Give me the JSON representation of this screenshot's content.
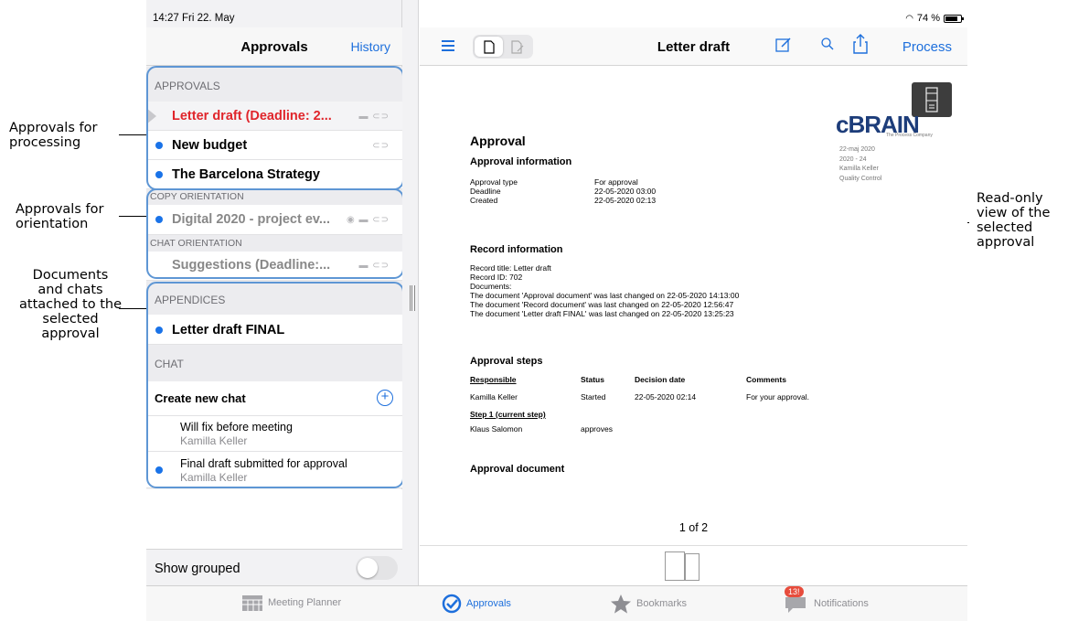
{
  "annotations": {
    "processing": "Approvals for processing",
    "orientation": "Approvals for orientation",
    "attached": "Documents and chats attached to the selected approval",
    "readonly": "Read-only view of the selected approval"
  },
  "status_bar": {
    "time": "14:27  Fri 22. May",
    "battery": "74 %"
  },
  "left_header": {
    "title": "Approvals",
    "history": "History"
  },
  "sections": {
    "approvals": "APPROVALS",
    "copy_orientation": "COPY ORIENTATION",
    "chat_orientation": "CHAT ORIENTATION",
    "appendices": "APPENDICES",
    "chat": "CHAT"
  },
  "approvals": [
    {
      "label": "Letter draft (Deadline: 2...",
      "icons": "▬ ⊂⊃"
    },
    {
      "label": "New budget",
      "icons": "⊂⊃"
    },
    {
      "label": "The Barcelona Strategy",
      "icons": ""
    }
  ],
  "copy_orientation_item": {
    "label": "Digital 2020 - project ev...",
    "icons": "◉ ▬ ⊂⊃"
  },
  "chat_orientation_item": {
    "label": "Suggestions (Deadline:...",
    "icons": "▬ ⊂⊃"
  },
  "appendix_item": {
    "label": "Letter draft FINAL"
  },
  "chat": {
    "create_new": "Create new chat",
    "items": [
      {
        "title": "Will fix before meeting",
        "author": "Kamilla Keller"
      },
      {
        "title": "Final draft submitted for approval",
        "author": "Kamilla Keller"
      }
    ]
  },
  "show_grouped": "Show grouped",
  "right_header": {
    "title": "Letter draft",
    "process": "Process"
  },
  "document": {
    "heading": "Approval",
    "logo": "cBRAIN",
    "logo_sub": "The Process Company",
    "meta": [
      "22-maj 2020",
      "2020 - 24",
      "Kamilla Keller",
      "Quality Control"
    ],
    "approval_info_title": "Approval information",
    "approval_info": [
      {
        "k": "Approval type",
        "v": "For approval"
      },
      {
        "k": "Deadline",
        "v": "22-05-2020 03:00"
      },
      {
        "k": "Created",
        "v": "22-05-2020 02:13"
      }
    ],
    "record_info_title": "Record information",
    "record_info": [
      "Record title: Letter draft",
      "Record ID: 702",
      "Documents:",
      "The document 'Approval document' was last changed on 22-05-2020 14:13:00",
      "The document 'Record document' was last changed on 22-05-2020 12:56:47",
      "The document 'Letter draft FINAL' was last changed on 22-05-2020 13:25:23"
    ],
    "steps_title": "Approval steps",
    "steps_headers": {
      "responsible": "Responsible",
      "status": "Status",
      "decision": "Decision date",
      "comments": "Comments"
    },
    "steps_row1": {
      "responsible": "Kamilla Keller",
      "status": "Started",
      "decision": "22-05-2020 02:14",
      "comments": "For your approval."
    },
    "step_label": "Step 1 (current step)",
    "steps_row2": {
      "responsible": "Klaus Salomon",
      "status": "approves"
    },
    "approval_document_title": "Approval document",
    "pager": "1 of 2"
  },
  "tabs": {
    "meeting_planner": "Meeting Planner",
    "approvals": "Approvals",
    "bookmarks": "Bookmarks",
    "notifications": "Notifications",
    "notifications_badge": "13!"
  },
  "colors": {
    "accent": "#1d6fdc",
    "deadline_red": "#e0252b",
    "group_outline": "#5e96d4",
    "unread_dot": "#1a73e8"
  }
}
